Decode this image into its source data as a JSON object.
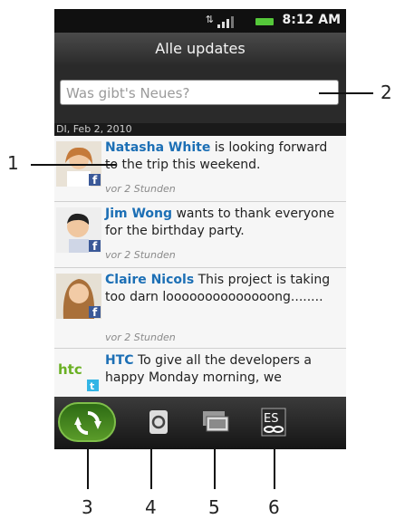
{
  "status_bar": {
    "time": "8:12 AM"
  },
  "title_bar": {
    "title": "Alle updates"
  },
  "compose": {
    "placeholder": "Was gibt's Neues?"
  },
  "feed": {
    "date_header": "DI, Feb 2, 2010",
    "items": [
      {
        "name": "Natasha White",
        "text": " is looking forward to the trip this weekend.",
        "time": "vor 2 Stunden"
      },
      {
        "name": "Jim Wong",
        "text": " wants to thank everyone for the birthday party.",
        "time": "vor 2 Stunden"
      },
      {
        "name": "Claire Nicols",
        "text": " This project is taking too darn loooooooooooooong........",
        "time": "vor 2 Stunden"
      },
      {
        "name": "HTC",
        "text": " To give all the developers a happy Monday morning, we",
        "time": ""
      }
    ],
    "htc_logo_text": "htc"
  },
  "bottom_tabs": [
    {
      "icon": "refresh-all-icon"
    },
    {
      "icon": "refresh-icon"
    },
    {
      "icon": "photos-icon"
    },
    {
      "icon": "accounts-link-icon"
    }
  ],
  "callouts": [
    "1",
    "2",
    "3",
    "4",
    "5",
    "6"
  ]
}
